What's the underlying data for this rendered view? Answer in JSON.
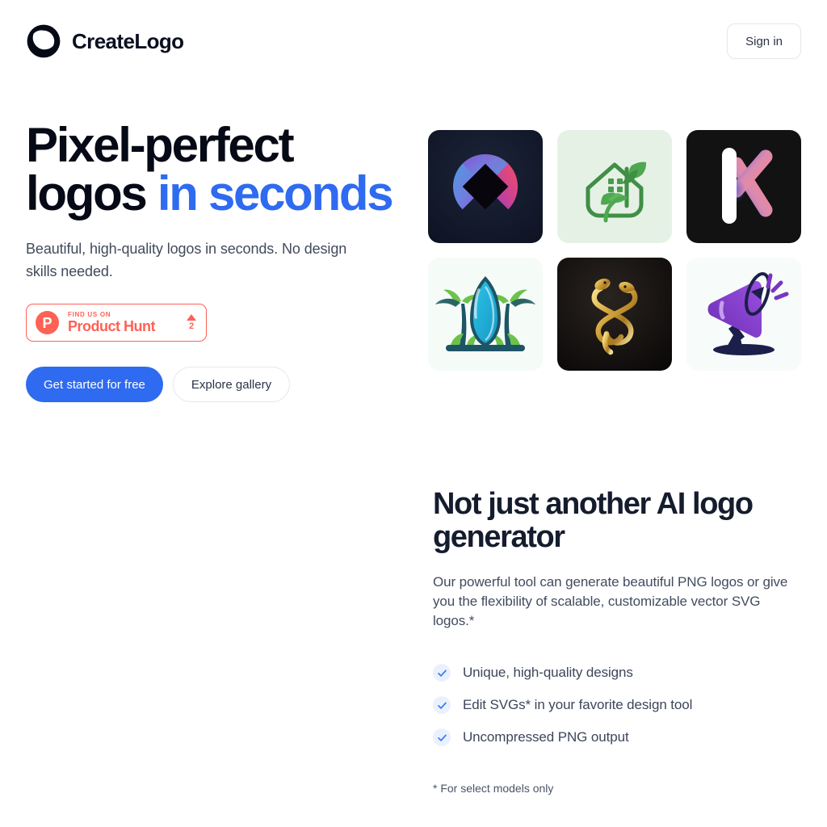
{
  "header": {
    "brand_name": "CreateLogo",
    "brand_mark_icon": "spiral-circle-logo-icon",
    "signin_label": "Sign in"
  },
  "hero": {
    "title_line1": "Pixel-perfect",
    "title_line2_plain": "logos ",
    "title_line2_accent": "in seconds",
    "subtitle": "Beautiful, high-quality logos in seconds. No design skills needed.",
    "product_hunt": {
      "icon": "product-hunt-p-icon",
      "eyebrow": "FIND US ON",
      "name": "Product Hunt",
      "upvote_icon": "upvote-triangle-icon",
      "upvote_count": "2",
      "color": "#ff6154"
    },
    "cta_primary": "Get started for free",
    "cta_secondary": "Explore gallery",
    "accent_color": "#2f6bf0"
  },
  "gallery": {
    "tiles": [
      {
        "name": "gradient-orb-logo",
        "bg": "#141a2c",
        "alt": "Dark navy tile with blue-purple-red gradient circle and dark diamond cutout"
      },
      {
        "name": "eco-house-leaf-logo",
        "bg": "#e4f0e4",
        "alt": "Mint tile with green house outline and leaves"
      },
      {
        "name": "letter-k-gradient-logo",
        "bg": "#111111",
        "alt": "Black tile with white and pink gradient letter K"
      },
      {
        "name": "surfboard-palm-logo",
        "bg": "#f4fbf7",
        "alt": "White tile with cyan surfboard between green palm trees"
      },
      {
        "name": "gold-serpent-logo",
        "bg": "#100c0a",
        "alt": "Dark tile with intertwined gold snakes"
      },
      {
        "name": "purple-megaphone-logo",
        "bg": "#f6fbf8",
        "alt": "White tile with purple megaphone"
      }
    ]
  },
  "lower": {
    "title": "Not just another AI logo generator",
    "subtitle": "Our powerful tool can generate beautiful PNG logos or give you the flexibility of scalable, customizable vector SVG logos.*",
    "features": [
      {
        "icon": "check-icon",
        "label": "Unique, high-quality designs"
      },
      {
        "icon": "check-icon",
        "label": "Edit SVGs* in your favorite design tool"
      },
      {
        "icon": "check-icon",
        "label": "Uncompressed PNG output"
      }
    ],
    "footnote": "* For select models only"
  }
}
